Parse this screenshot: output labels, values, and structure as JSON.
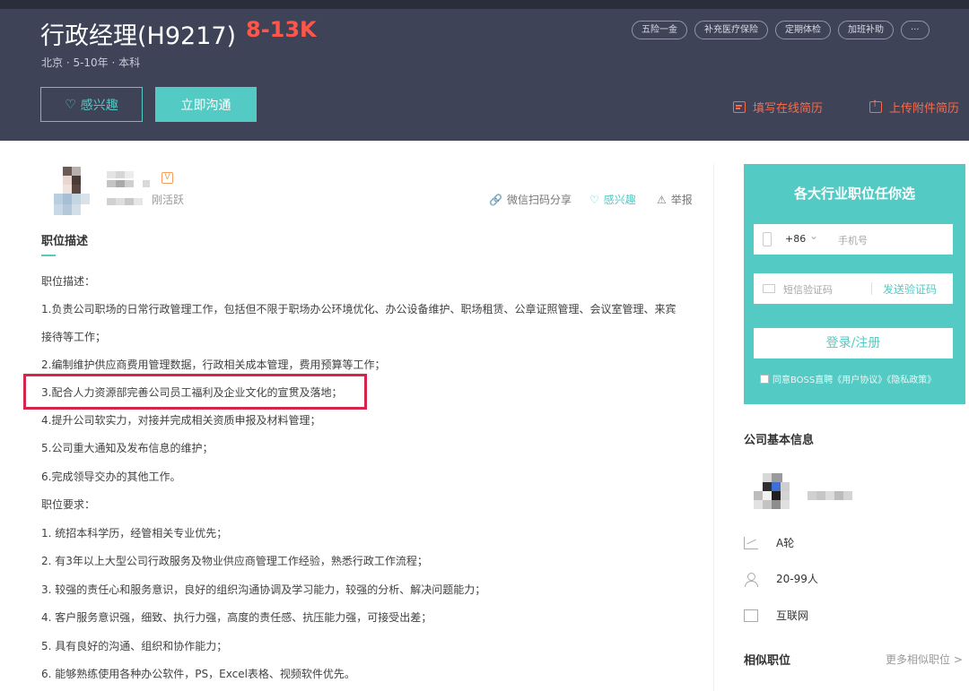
{
  "header": {
    "title": "行政经理(H9217)",
    "salary": "8-13K",
    "meta": "北京 · 5-10年 · 本科",
    "tags": [
      "五险一金",
      "补充医疗保险",
      "定期体检",
      "加班补助",
      "···"
    ],
    "interest_button": "感兴趣",
    "chat_button": "立即沟通",
    "fill_resume": "填写在线简历",
    "upload_resume": "上传附件简历"
  },
  "recruiter": {
    "status": "刚活跃",
    "badge": "V",
    "actions": {
      "share": "微信扫码分享",
      "interest": "感兴趣",
      "report": "举报"
    }
  },
  "description": {
    "section_title": "职位描述",
    "lines": [
      "职位描述：",
      "1.负责公司职场的日常行政管理工作，包括但不限于职场办公环境优化、办公设备维护、职场租赁、公章证照管理、会议室管理、来宾",
      "接待等工作；",
      "2.编制维护供应商费用管理数据，行政相关成本管理，费用预算等工作；",
      "3.配合人力资源部完善公司员工福利及企业文化的宣贯及落地；",
      "4.提升公司软实力，对接并完成相关资质申报及材料管理；",
      "5.公司重大通知及发布信息的维护；",
      "6.完成领导交办的其他工作。",
      "职位要求：",
      "1. 统招本科学历，经管相关专业优先；",
      "2. 有3年以上大型公司行政服务及物业供应商管理工作经验，熟悉行政工作流程；",
      "3. 较强的责任心和服务意识，良好的组织沟通协调及学习能力，较强的分析、解决问题能力；",
      "4. 客户服务意识强，细致、执行力强，高度的责任感、抗压能力强，可接受出差；",
      "5. 具有良好的沟通、组织和协作能力；",
      "6. 能够熟练使用各种办公软件，PS，Excel表格、视频软件优先。"
    ]
  },
  "signup": {
    "title": "各大行业职位任你选",
    "country_code": "+86",
    "phone_placeholder": "手机号",
    "code_placeholder": "短信验证码",
    "send_code": "发送验证码",
    "login_button": "登录/注册",
    "agreement": "同意BOSS直聘《用户协议》《隐私政策》"
  },
  "company": {
    "section_title": "公司基本信息",
    "stage": "A轮",
    "size": "20-99人",
    "industry": "互联网"
  },
  "similar": {
    "title": "相似职位",
    "more": "更多相似职位 >"
  },
  "colors": {
    "header_bg": "#3e4358",
    "accent": "#53cac3",
    "salary": "#fe574a",
    "highlight_border": "#d2264a"
  }
}
